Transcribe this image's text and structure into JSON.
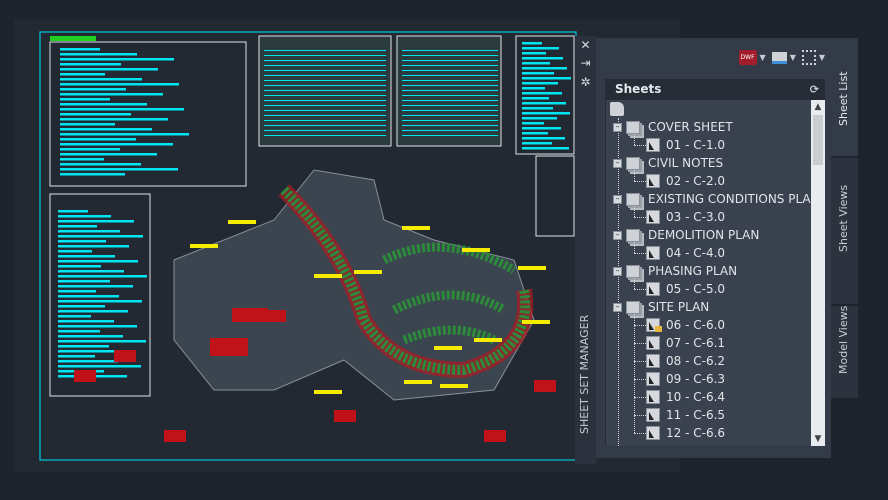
{
  "palette": {
    "cyan": "#00e5f2",
    "yellow": "#f5ec00",
    "red": "#c0121a",
    "green": "#2c8a3a",
    "panel": "#333b48"
  },
  "palette_strip": {
    "title": "SHEET SET MANAGER",
    "icons": [
      "close-icon",
      "auto-hide-icon",
      "properties-icon"
    ]
  },
  "toolbar": {
    "buttons": [
      {
        "icon": "publish-dwf-icon",
        "label": "DWF"
      },
      {
        "icon": "plot-icon"
      },
      {
        "icon": "sheet-selections-icon"
      }
    ]
  },
  "sheets": {
    "title": "Sheets",
    "tree": [
      {
        "label": "COVER SHEET",
        "sheets": [
          {
            "label": "01 - C-1.0"
          }
        ]
      },
      {
        "label": "CIVIL NOTES",
        "sheets": [
          {
            "label": "02 - C-2.0"
          }
        ]
      },
      {
        "label": "EXISTING CONDITIONS PLAN",
        "sheets": [
          {
            "label": "03 - C-3.0"
          }
        ]
      },
      {
        "label": "DEMOLITION PLAN",
        "sheets": [
          {
            "label": "04 - C-4.0"
          }
        ]
      },
      {
        "label": "PHASING PLAN",
        "sheets": [
          {
            "label": "05 - C-5.0"
          }
        ]
      },
      {
        "label": "SITE PLAN",
        "sheets": [
          {
            "label": "06 - C-6.0",
            "locked": true
          },
          {
            "label": "07 - C-6.1"
          },
          {
            "label": "08 - C-6.2"
          },
          {
            "label": "09 - C-6.3"
          },
          {
            "label": "10 - C-6.4"
          },
          {
            "label": "11 - C-6.5"
          },
          {
            "label": "12 - C-6.6"
          }
        ]
      }
    ]
  },
  "tabs": [
    {
      "label": "Sheet List",
      "active": true
    },
    {
      "label": "Sheet Views"
    },
    {
      "label": "Model Views"
    }
  ]
}
